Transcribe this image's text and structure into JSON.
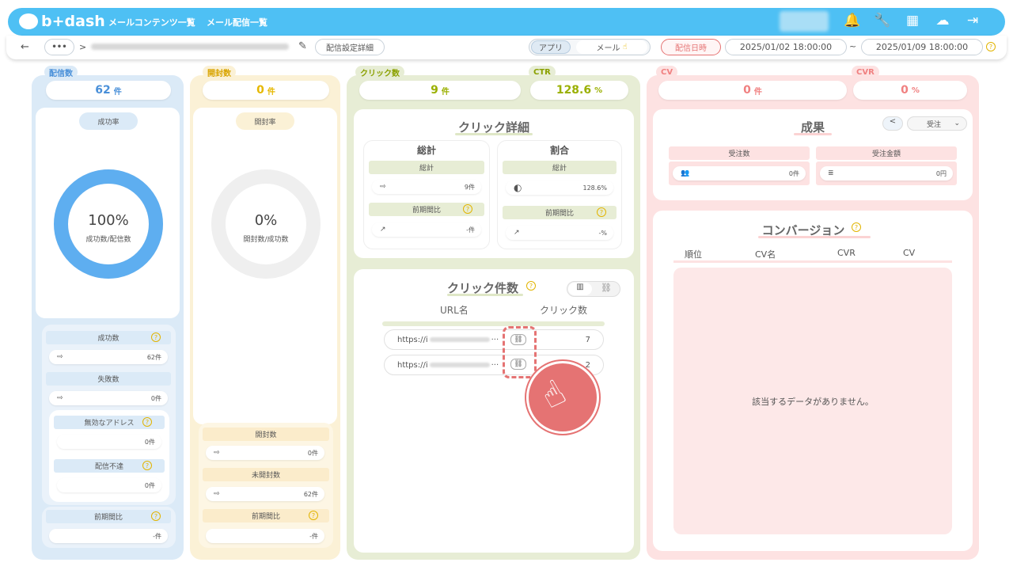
{
  "header": {
    "logo": "b+dash",
    "nav": [
      "メールコンテンツ一覧",
      "メール配信一覧"
    ],
    "icons": [
      "bell-icon",
      "wrench-icon",
      "grid-icon",
      "chat-icon",
      "logout-icon"
    ]
  },
  "toolbar": {
    "back": "←",
    "more": "•••",
    "separator": ">",
    "edit_icon": "✎",
    "settings_button": "配信設定詳細",
    "channel_app": "アプリ",
    "channel_mail": "メール",
    "date_label": "配信日時",
    "start_date": "2025/01/02 18:00:00",
    "tilde": "~",
    "end_date": "2025/01/09 18:00:00",
    "help": "?"
  },
  "delivery": {
    "tab": "配信数",
    "count": "62",
    "unit": "件",
    "rate_label": "成功率",
    "donut_value": "100%",
    "donut_caption": "成功数/配信数",
    "donut_fill": 1.0,
    "success_label": "成功数",
    "success_value": "62件",
    "fail_label": "失敗数",
    "fail_value": "0件",
    "invalid_label": "無効なアドレス",
    "invalid_value": "0件",
    "undeliverable_label": "配信不達",
    "undeliverable_value": "0件",
    "prev_label": "前期間比",
    "prev_value": "-件"
  },
  "open": {
    "tab": "開封数",
    "count": "0",
    "unit": "件",
    "rate_label": "開封率",
    "donut_value": "0%",
    "donut_caption": "開封数/成功数",
    "donut_fill": 0.0,
    "opened_label": "開封数",
    "opened_value": "0件",
    "unopened_label": "未開封数",
    "unopened_value": "62件",
    "prev_label": "前期間比",
    "prev_value": "-件"
  },
  "click": {
    "tab": "クリック数",
    "count": "9",
    "unit": "件",
    "ctr_tab": "CTR",
    "ctr_value": "128.6",
    "ctr_unit": "%",
    "detail_title": "クリック詳細",
    "total_title": "総計",
    "ratio_title": "割合",
    "total_label": "総計",
    "total_value": "9件",
    "ratio_total_label": "総計",
    "ratio_value": "128.6%",
    "prev_label": "前期間比",
    "prev_value": "-件",
    "ratio_prev_label": "前期間比",
    "ratio_prev_value": "-%",
    "count_title": "クリック件数",
    "col_url": "URL名",
    "col_clicks": "クリック数",
    "rows": [
      {
        "url": "https://i",
        "ellipsis": "···",
        "clicks": "7"
      },
      {
        "url": "https://i",
        "ellipsis": "···",
        "clicks": "2"
      }
    ]
  },
  "cv": {
    "tab": "CV",
    "count": "0",
    "unit": "件",
    "cvr_tab": "CVR",
    "cvr_value": "0",
    "cvr_unit": "%",
    "result_title": "成果",
    "select_value": "受注",
    "orders_label": "受注数",
    "orders_value": "0件",
    "amount_label": "受注金額",
    "amount_value": "0円",
    "conversion_title": "コンバージョン",
    "cols": [
      "順位",
      "CV名",
      "CVR",
      "CV"
    ],
    "empty_message": "該当するデータがありません。"
  },
  "colors": {
    "header": "#4ec0f4",
    "delivery": "#dbeaf7",
    "open": "#fbf1d6",
    "click": "#e7edd5",
    "cv": "#fde2e2",
    "donut_blue": "#5eaef0",
    "highlight": "#e57373"
  }
}
